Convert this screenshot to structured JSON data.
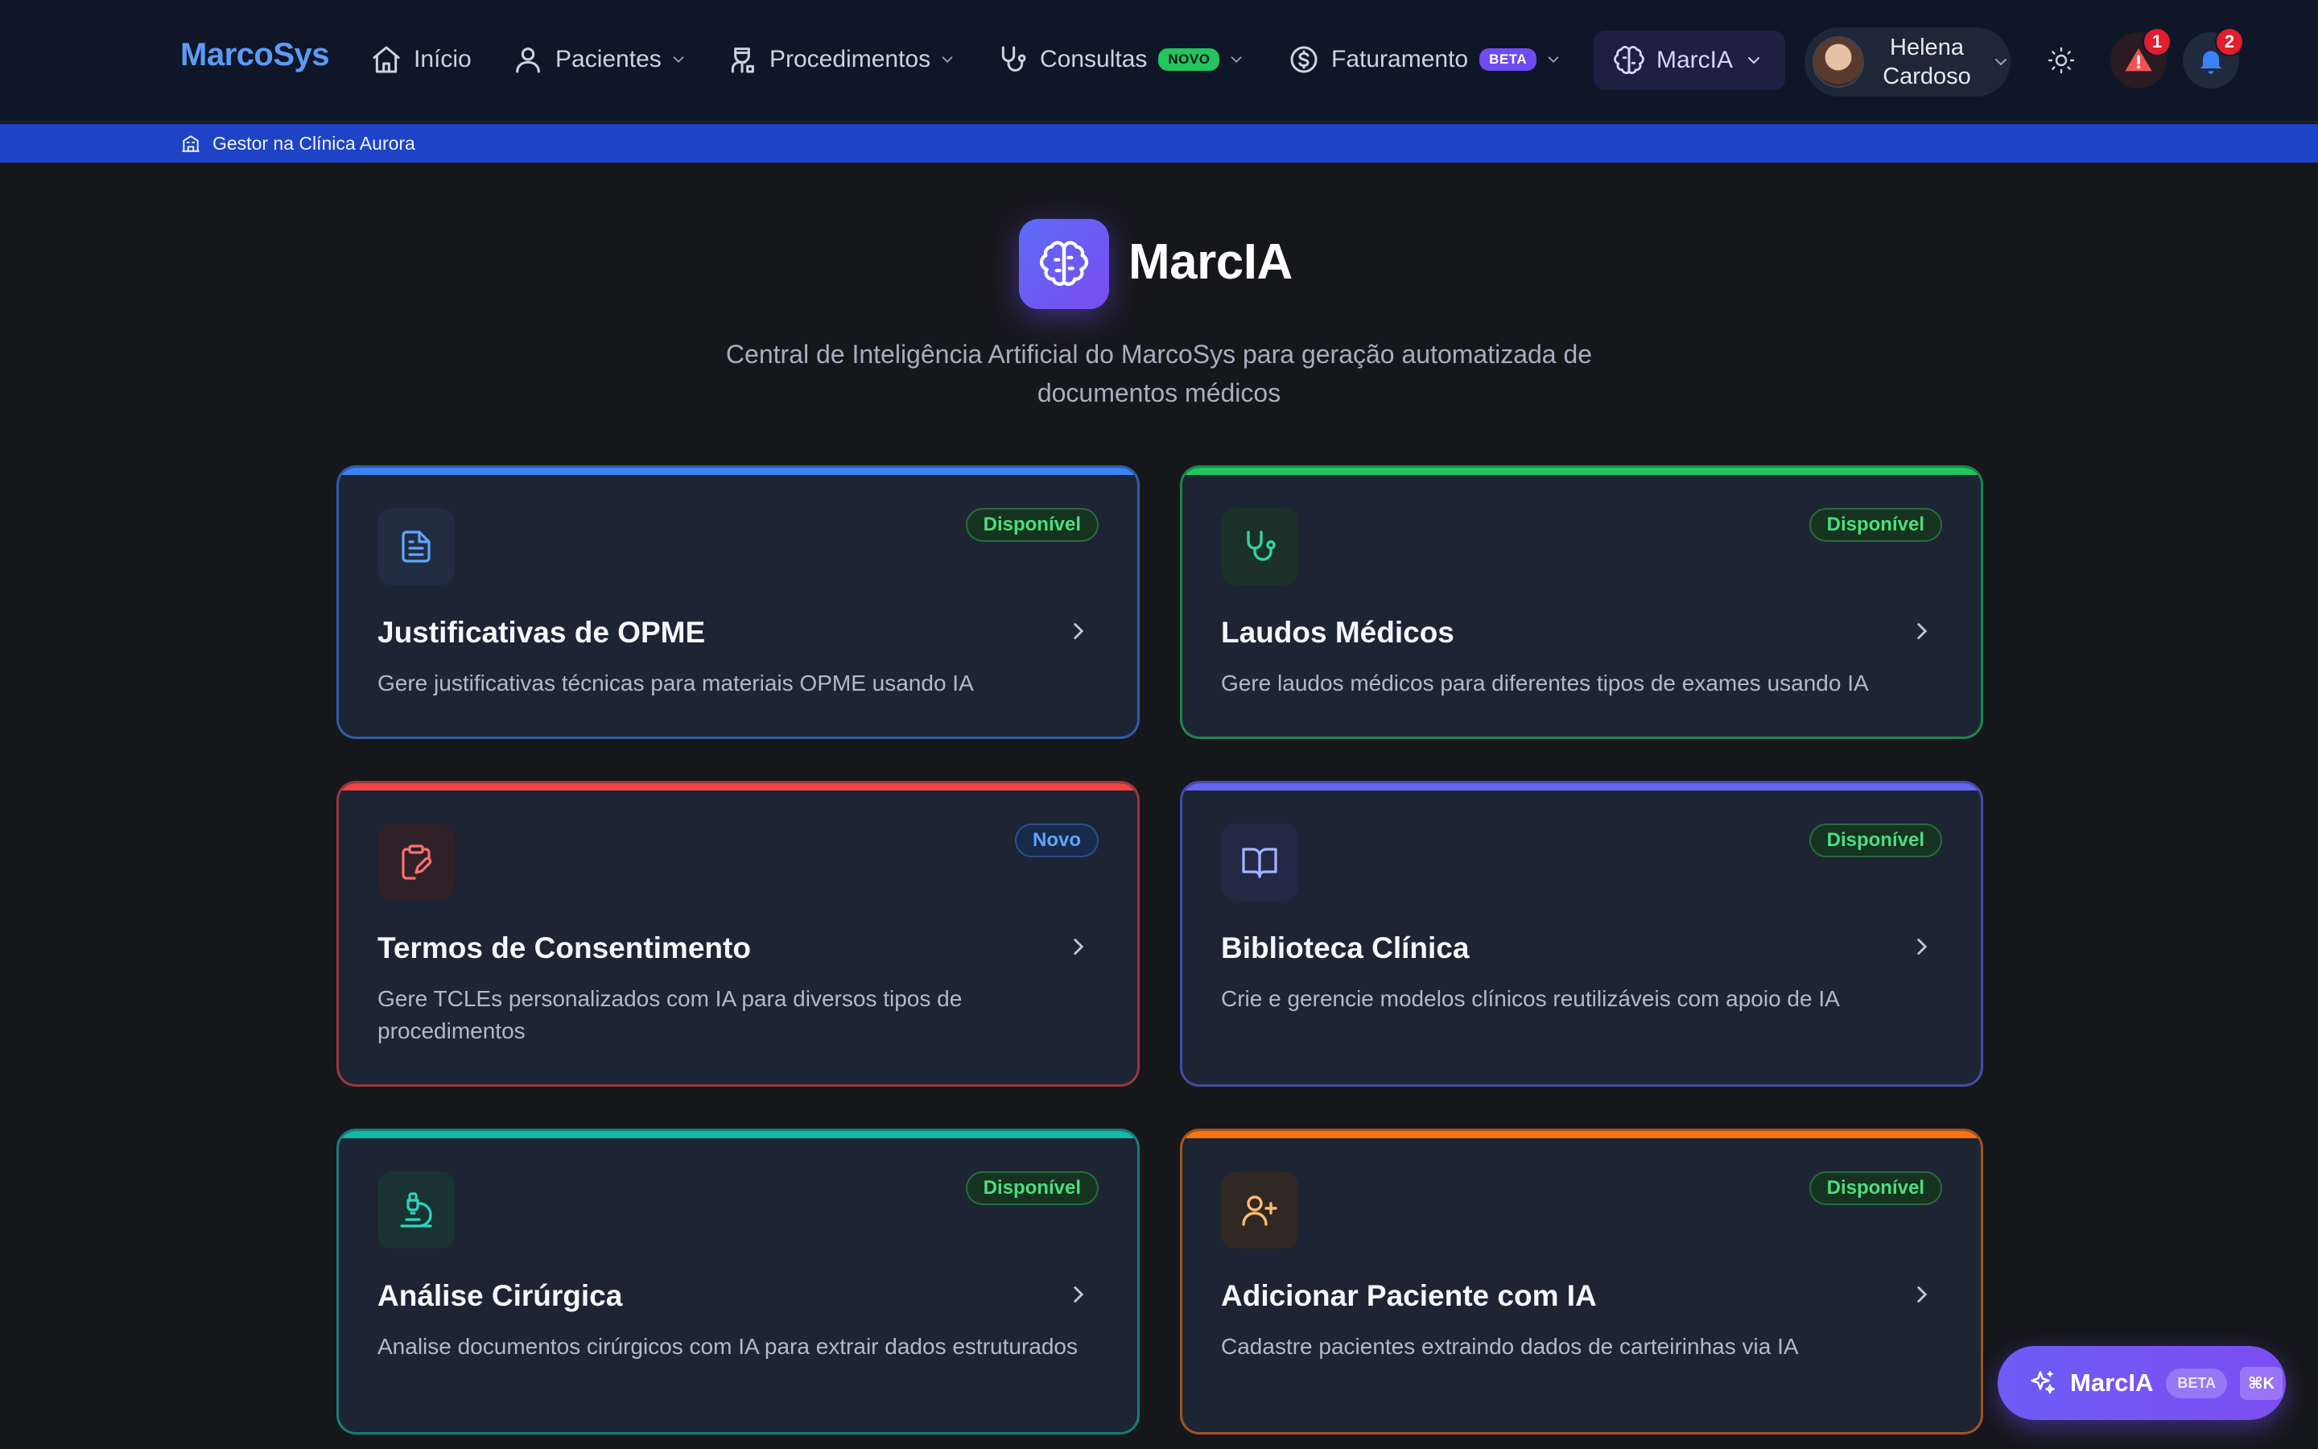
{
  "nav": {
    "brand": "MarcoSys",
    "items": [
      {
        "label": "Início"
      },
      {
        "label": "Pacientes"
      },
      {
        "label": "Procedimentos"
      },
      {
        "label": "Consultas",
        "badge": "NOVO"
      },
      {
        "label": "Faturamento",
        "badge": "BETA"
      }
    ],
    "marcia_label": "MarcIA",
    "user": {
      "first": "Helena",
      "last": "Cardoso"
    },
    "alerts_count": "1",
    "notifications_count": "2"
  },
  "clinic_bar": {
    "label": "Gestor na Clínica Aurora"
  },
  "hero": {
    "title": "MarcIA",
    "subtitle": "Central de Inteligência Artificial do MarcoSys para geração automatizada de documentos médicos"
  },
  "cards": [
    {
      "title": "Justificativas de OPME",
      "description": "Gere justificativas técnicas para materiais OPME usando IA",
      "status": "Disponível",
      "icon": "file-text-icon",
      "accent": "#3b82f6"
    },
    {
      "title": "Laudos Médicos",
      "description": "Gere laudos médicos para diferentes tipos de exames usando IA",
      "status": "Disponível",
      "icon": "stethoscope-icon",
      "accent": "#22c55e"
    },
    {
      "title": "Termos de Consentimento",
      "description": "Gere TCLEs personalizados com IA para diversos tipos de procedimentos",
      "status": "Novo",
      "icon": "clipboard-pen-icon",
      "accent": "#ef4444"
    },
    {
      "title": "Biblioteca Clínica",
      "description": "Crie e gerencie modelos clínicos reutilizáveis com apoio de IA",
      "status": "Disponível",
      "icon": "book-open-icon",
      "accent": "#6366f1"
    },
    {
      "title": "Análise Cirúrgica",
      "description": "Analise documentos cirúrgicos com IA para extrair dados estruturados",
      "status": "Disponível",
      "icon": "microscope-icon",
      "accent": "#14b8a6"
    },
    {
      "title": "Adicionar Paciente com IA",
      "description": "Cadastre pacientes extraindo dados de carteirinhas via IA",
      "status": "Disponível",
      "icon": "user-plus-icon",
      "accent": "#f97316"
    }
  ],
  "fab": {
    "label": "MarcIA",
    "badge": "BETA",
    "shortcut": "⌘K"
  }
}
